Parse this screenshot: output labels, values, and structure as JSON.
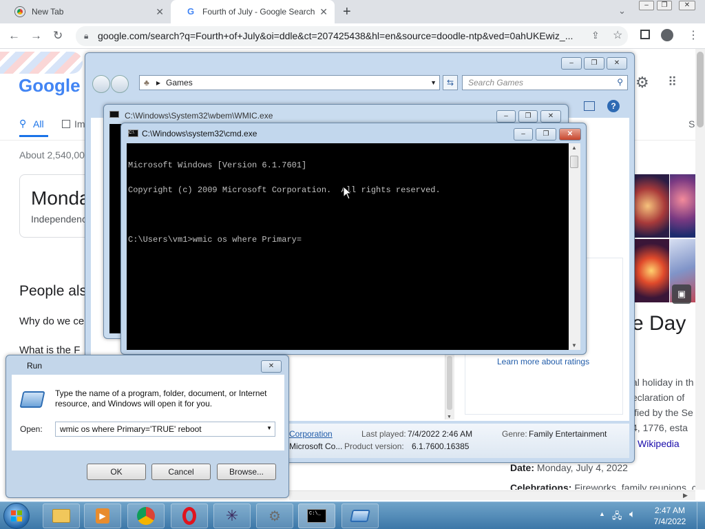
{
  "browser": {
    "tabs": [
      {
        "title": "New Tab"
      },
      {
        "title": "Fourth of July - Google Search"
      }
    ],
    "url": "google.com/search?q=Fourth+of+July&oi=ddle&ct=207425438&hl=en&source=doodle-ntp&ved=0ahUKEwiz_..."
  },
  "google": {
    "logo": "Google",
    "tabs": [
      "All",
      "Im"
    ],
    "tab_right": "S",
    "result_count": "About 2,540,00",
    "card_title": "Monda",
    "card_sub": "Independenc",
    "people_also": "People als",
    "q1": "Why do we ce",
    "q2": "What is the F",
    "kp_title": "e Day",
    "kp_ratings": "Learn more about ratings",
    "kp_lines": [
      "al holiday in th",
      "eclaration of",
      "ified by the Se",
      "4, 1776, esta"
    ],
    "wiki": "Wikipedia",
    "date_label": "Date:",
    "date_value": "Monday, July 4, 2022",
    "celebrations_label": "Celebrations:",
    "celebrations_value": "Fireworks, family reunions, c"
  },
  "games": {
    "breadcrumb": "Games",
    "search_placeholder": "Search Games",
    "publisher_link": "Corporation",
    "publisher": "Microsoft Co...",
    "last_played_label": "Last played:",
    "last_played": "7/4/2022 2:46 AM",
    "genre_label": "Genre:",
    "genre": "Family Entertainment",
    "product_label": "Product version:",
    "product_version": "6.1.7600.16385"
  },
  "wmic": {
    "title": "C:\\Windows\\System32\\wbem\\WMIC.exe"
  },
  "cmd": {
    "title": "C:\\Windows\\system32\\cmd.exe",
    "line1": "Microsoft Windows [Version 6.1.7601]",
    "line2": "Copyright (c) 2009 Microsoft Corporation.  All rights reserved.",
    "line3": "C:\\Users\\vm1>wmic os where Primary="
  },
  "run": {
    "title": "Run",
    "description": "Type the name of a program, folder, document, or Internet resource, and Windows will open it for you.",
    "open_label": "Open:",
    "open_value": "wmic os where Primary='TRUE' reboot",
    "ok": "OK",
    "cancel": "Cancel",
    "browse": "Browse..."
  },
  "taskbar": {
    "time": "2:47 AM",
    "date": "7/4/2022"
  }
}
